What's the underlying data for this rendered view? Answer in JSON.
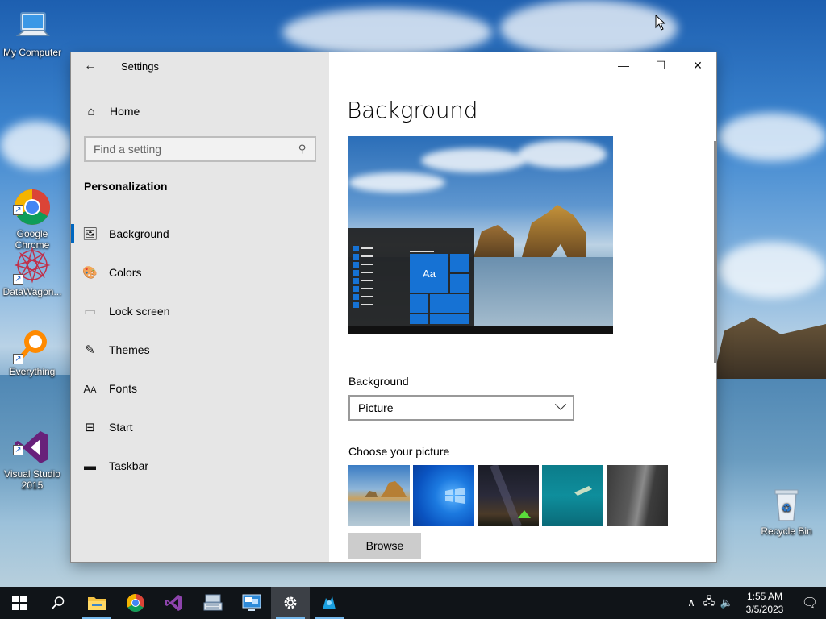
{
  "desktop": {
    "icons": [
      {
        "label": "My Computer"
      },
      {
        "label": "Google\nChrome"
      },
      {
        "label": "DataWagon..."
      },
      {
        "label": "Everything"
      },
      {
        "label": "Visual Studio\n2015"
      },
      {
        "label": "Recycle Bin"
      }
    ]
  },
  "window": {
    "title": "Settings",
    "controls": {
      "minimize": "—",
      "maximize": "☐",
      "close": "✕"
    }
  },
  "sidebar": {
    "home": "Home",
    "search_placeholder": "Find a setting",
    "section": "Personalization",
    "items": [
      {
        "label": "Background"
      },
      {
        "label": "Colors"
      },
      {
        "label": "Lock screen"
      },
      {
        "label": "Themes"
      },
      {
        "label": "Fonts"
      },
      {
        "label": "Start"
      },
      {
        "label": "Taskbar"
      }
    ]
  },
  "main": {
    "title": "Background",
    "preview_tile_text": "Aa",
    "background_label": "Background",
    "background_value": "Picture",
    "choose_label": "Choose your picture",
    "browse_label": "Browse"
  },
  "taskbar": {
    "time": "1:55 AM",
    "date": "3/5/2023"
  },
  "colors": {
    "accent": "#0067c0",
    "taskbar": "#101418",
    "sidebar": "#e6e6e6"
  }
}
